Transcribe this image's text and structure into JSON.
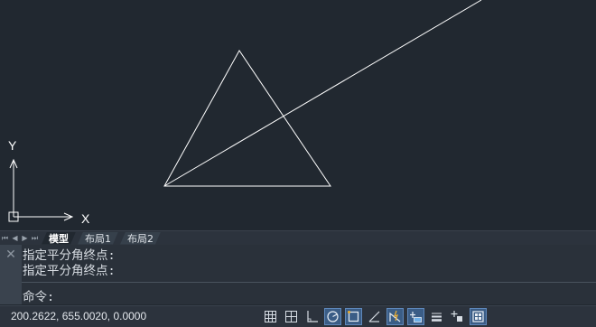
{
  "drawing": {
    "ucs": {
      "y_label": "Y",
      "x_label": "X"
    }
  },
  "tabs": {
    "nav": [
      "first-icon",
      "prev-icon",
      "next-icon",
      "last-icon"
    ],
    "items": [
      {
        "label": "模型",
        "active": true
      },
      {
        "label": "布局1",
        "active": false
      },
      {
        "label": "布局2",
        "active": false
      }
    ]
  },
  "command": {
    "close_glyph": "✕",
    "history": [
      "指定平分角终点:",
      "指定平分角终点:"
    ],
    "prompt": "命令:"
  },
  "status": {
    "coordinates": "200.2622, 655.0020, 0.0000",
    "icons": [
      {
        "name": "grid-display-icon",
        "on": false
      },
      {
        "name": "snap-mode-icon",
        "on": false
      },
      {
        "name": "ortho-mode-icon",
        "on": false
      },
      {
        "name": "polar-tracking-icon",
        "on": true
      },
      {
        "name": "object-snap-icon",
        "on": true
      },
      {
        "name": "object-snap-tracking-icon",
        "on": false
      },
      {
        "name": "dynamic-ucs-icon",
        "on": true
      },
      {
        "name": "dynamic-input-icon",
        "on": true
      },
      {
        "name": "lineweight-icon",
        "on": false
      },
      {
        "name": "selection-cycling-icon",
        "on": false
      },
      {
        "name": "workspace-icon",
        "on": true
      }
    ]
  },
  "colors": {
    "canvas": "#212830",
    "geometry": "#ffffff",
    "active_toggle": "#3b5d86"
  }
}
